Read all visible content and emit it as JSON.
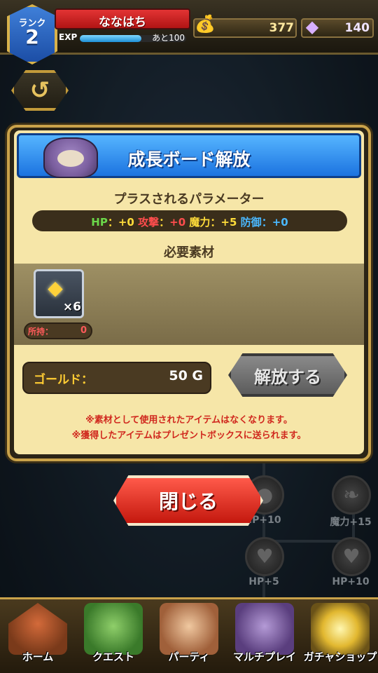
{
  "header": {
    "rank_label": "ランク",
    "rank_value": "2",
    "player_name": "ななはち",
    "exp_label": "EXP",
    "exp_remaining": "あと100",
    "exp_progress": 0.58,
    "gold": "377",
    "gems": "140"
  },
  "background_nodes": [
    {
      "label": "HP+10"
    },
    {
      "label": "魔力+15"
    },
    {
      "label": "HP+5"
    },
    {
      "label": "HP+10"
    }
  ],
  "dialog": {
    "title": "成長ボード解放",
    "params_heading": "プラスされるパラメーター",
    "params": {
      "hp_label": "HP",
      "hp_value": "+0",
      "atk_label": "攻撃",
      "atk_value": "+0",
      "mag_label": "魔力",
      "mag_value": "+5",
      "def_label": "防御",
      "def_value": "+0",
      "separator": "："
    },
    "materials_heading": "必要素材",
    "material": {
      "count": "×6",
      "owned_label": "所持：",
      "owned_value": "0"
    },
    "gold_label": "ゴールド：",
    "gold_cost": "50 G",
    "unlock_button": "解放する",
    "note1": "※素材として使用されたアイテムはなくなります。",
    "note2": "※獲得したアイテムはプレゼントボックスに送られます。"
  },
  "close_button": "閉じる",
  "nav": {
    "items": [
      {
        "label": "ホーム"
      },
      {
        "label": "クエスト"
      },
      {
        "label": "パーティ"
      },
      {
        "label": "マルチプレイ"
      },
      {
        "label": "ガチャショップ"
      }
    ]
  },
  "colors": {
    "hp": "#6bd84a",
    "attack": "#ff4d4d",
    "magic": "#ffdc3a",
    "defense": "#4ab8ff",
    "note": "#d0281e"
  }
}
